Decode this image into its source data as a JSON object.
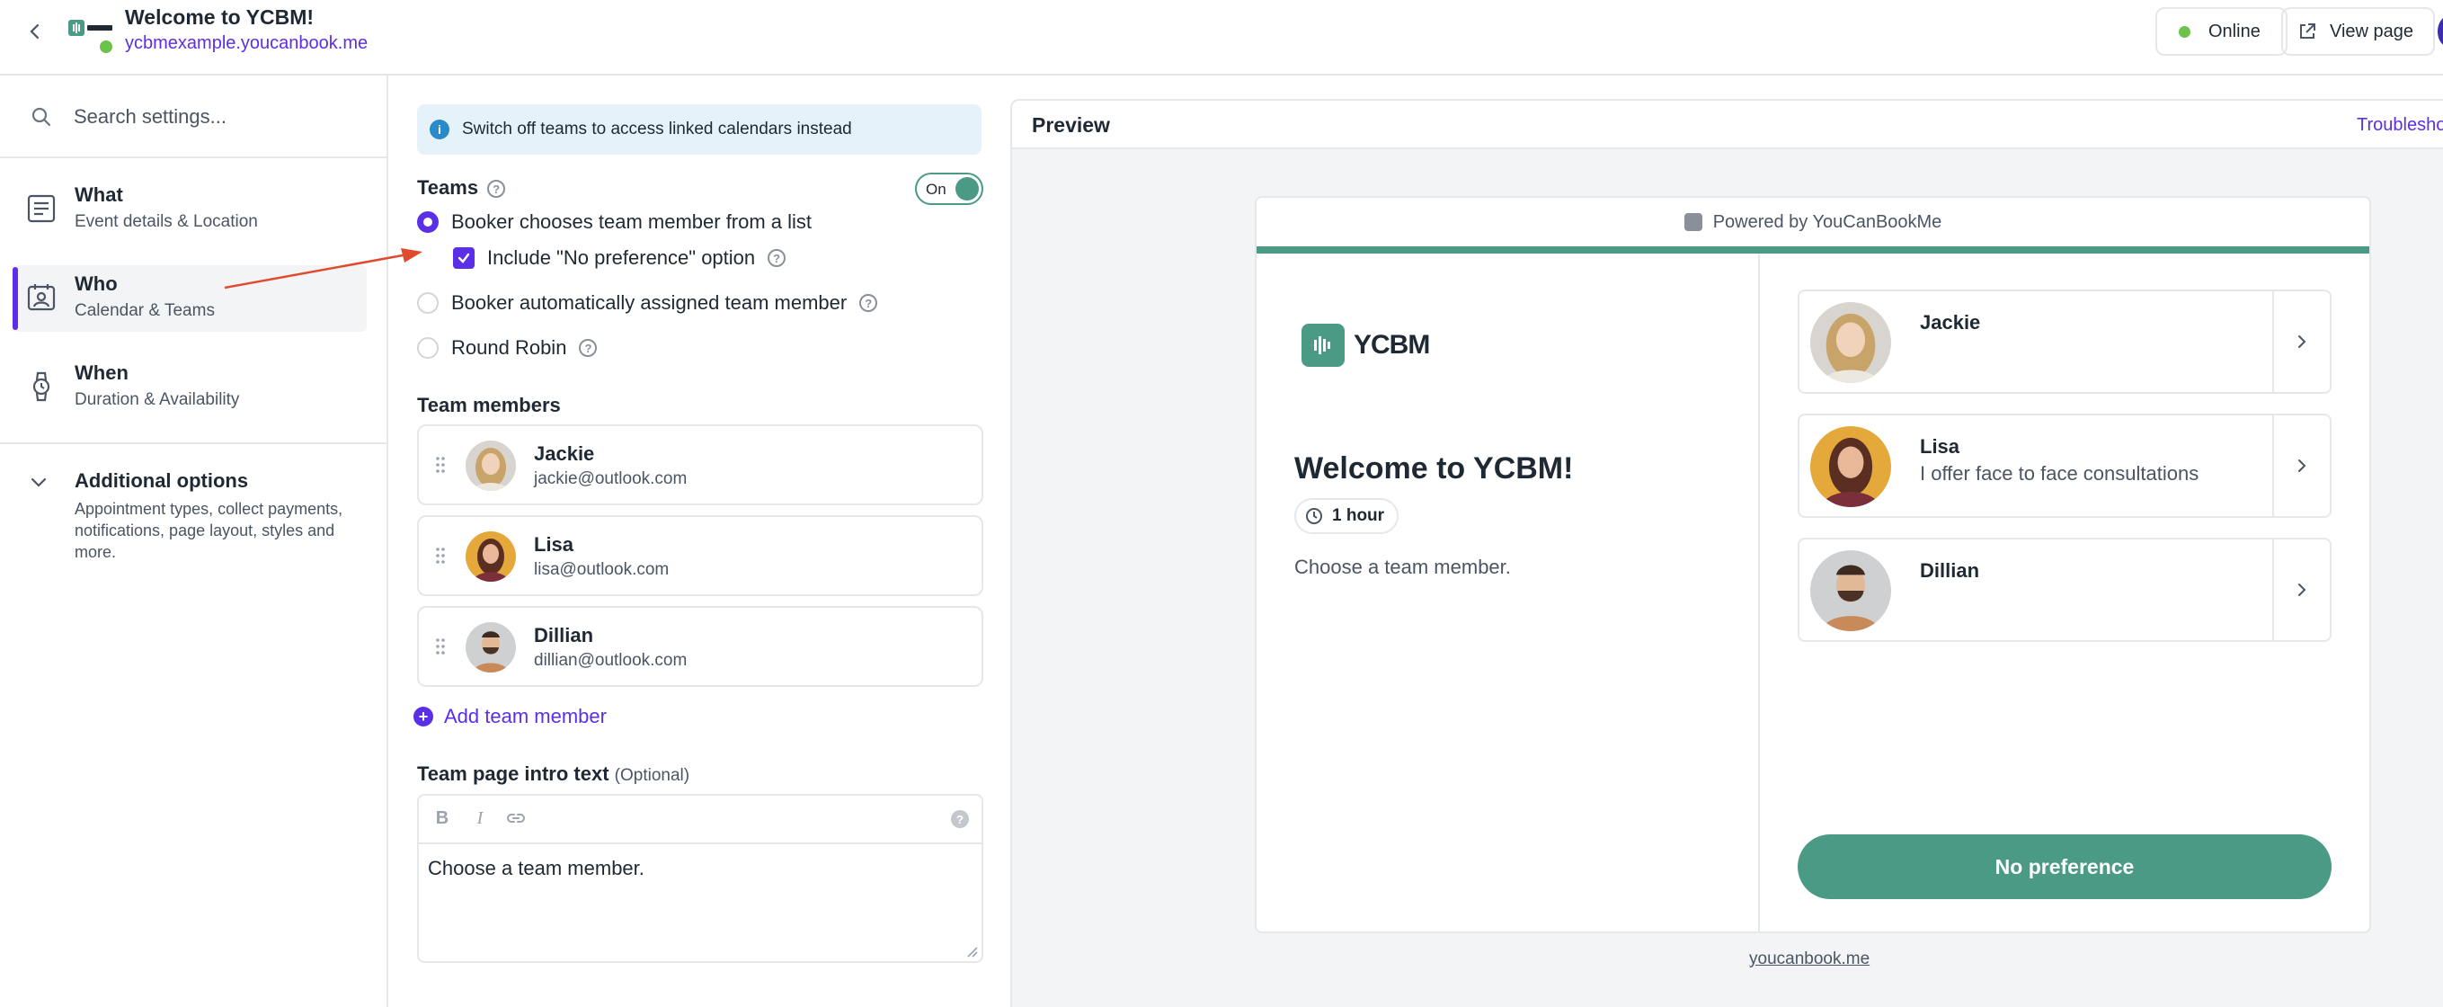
{
  "header": {
    "title": "Welcome to YCBM!",
    "url": "ycbmexample.youcanbook.me",
    "status_label": "Online",
    "status_color": "#6cc24a",
    "view_page_label": "View page"
  },
  "sidebar": {
    "search_placeholder": "Search settings...",
    "items": [
      {
        "title": "What",
        "subtitle": "Event details & Location",
        "icon": "what-icon"
      },
      {
        "title": "Who",
        "subtitle": "Calendar & Teams",
        "icon": "who-icon",
        "active": true
      },
      {
        "title": "When",
        "subtitle": "Duration & Availability",
        "icon": "watch-icon"
      }
    ],
    "additional": {
      "title": "Additional options",
      "subtitle": "Appointment types, collect payments, notifications, page layout, styles and more."
    }
  },
  "settings": {
    "info_text": "Switch off teams to access linked calendars instead",
    "teams_label": "Teams",
    "toggle_label": "On",
    "options": {
      "list": "Booker chooses team member from a list",
      "no_preference": "Include \"No preference\" option",
      "auto": "Booker automatically assigned team member",
      "round_robin": "Round Robin"
    },
    "team_members_label": "Team members",
    "members": [
      {
        "name": "Jackie",
        "email": "jackie@outlook.com"
      },
      {
        "name": "Lisa",
        "email": "lisa@outlook.com"
      },
      {
        "name": "Dillian",
        "email": "dillian@outlook.com"
      }
    ],
    "add_member_label": "Add team member",
    "intro_label": "Team page intro text",
    "intro_optional": "(Optional)",
    "intro_toolbar": {
      "bold": "B",
      "italic": "I"
    },
    "intro_text": "Choose a team member."
  },
  "preview": {
    "title": "Preview",
    "troubleshoot_label": "Troubleshoot",
    "powered_by": "Powered by YouCanBookMe",
    "logo_text": "YCBM",
    "booking_title": "Welcome to YCBM!",
    "duration": "1 hour",
    "description": "Choose a team member.",
    "people": [
      {
        "name": "Jackie",
        "desc": ""
      },
      {
        "name": "Lisa",
        "desc": "I offer face to face consultations"
      },
      {
        "name": "Dillian",
        "desc": ""
      }
    ],
    "no_preference_label": "No preference",
    "footer_link": "youcanbook.me"
  },
  "colors": {
    "accent": "#5b2ee8",
    "teal": "#4a9a86",
    "annotation_arrow": "#e04b2e"
  }
}
